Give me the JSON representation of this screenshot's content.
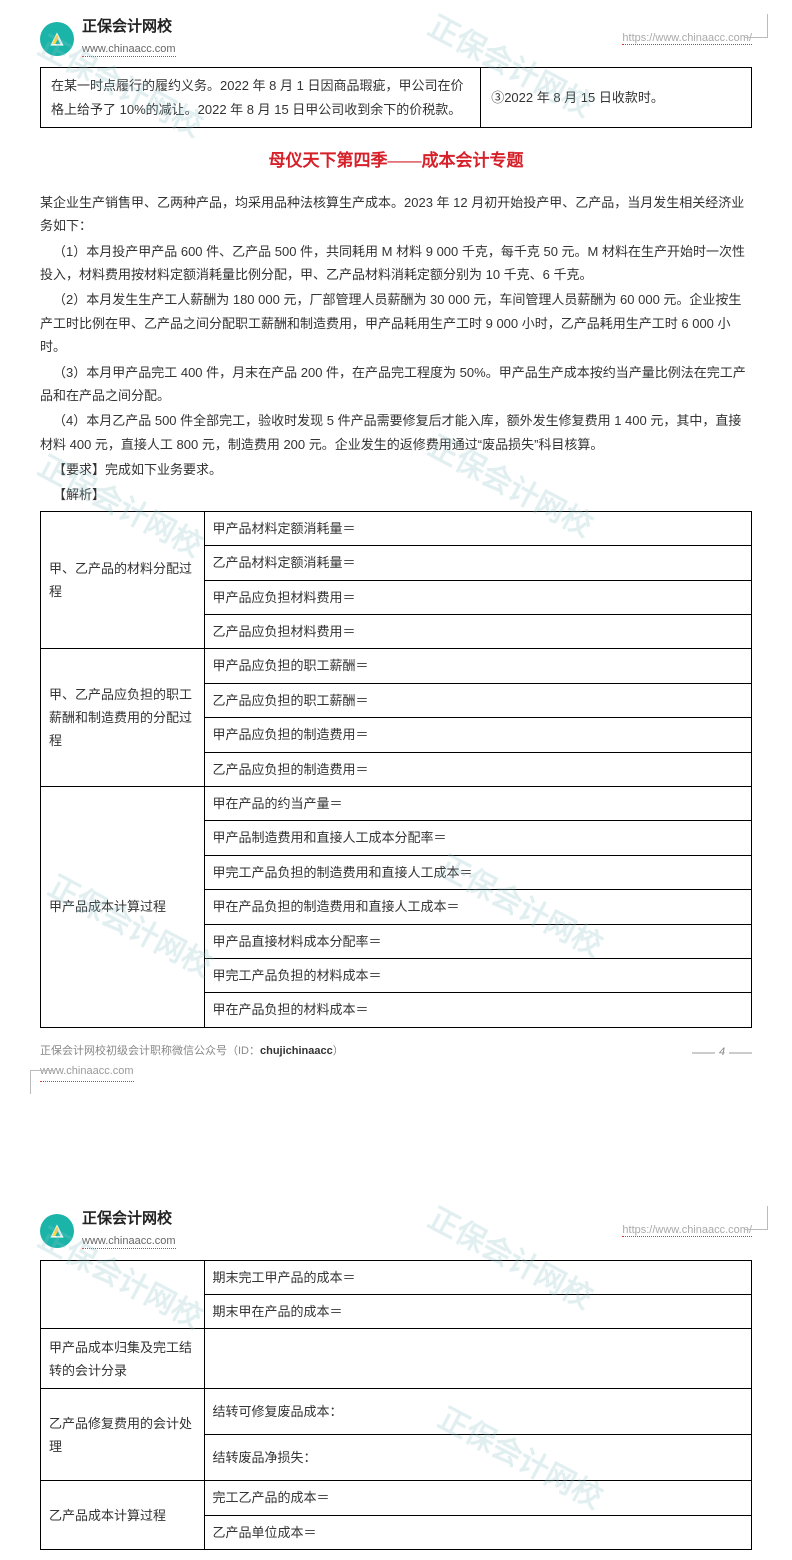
{
  "brand": {
    "cn": "正保会计网校",
    "en": "www.chinaacc.com"
  },
  "header_url": "https://www.chinaacc.com/",
  "topbox": {
    "left": "在某一时点履行的履约义务。2022 年 8 月 1 日因商品瑕疵，甲公司在价格上给予了 10%的减让。2022 年 8 月 15 日甲公司收到余下的价税款。",
    "right": "③2022 年 8 月 15 日收款时。"
  },
  "title": "母仪天下第四季——成本会计专题",
  "body": {
    "p1": "某企业生产销售甲、乙两种产品，均采用品种法核算生产成本。2023 年 12 月初开始投产甲、乙产品，当月发生相关经济业务如下：",
    "p2": "（1）本月投产甲产品 600 件、乙产品 500 件，共同耗用 M 材料 9 000 千克，每千克 50 元。M 材料在生产开始时一次性投入，材料费用按材料定额消耗量比例分配，甲、乙产品材料消耗定额分别为 10 千克、6 千克。",
    "p3": "（2）本月发生生产工人薪酬为 180 000 元，厂部管理人员薪酬为 30 000 元，车间管理人员薪酬为 60 000 元。企业按生产工时比例在甲、乙产品之间分配职工薪酬和制造费用，甲产品耗用生产工时 9 000 小时，乙产品耗用生产工时 6 000 小时。",
    "p4": "（3）本月甲产品完工 400 件，月末在产品 200 件，在产品完工程度为 50%。甲产品生产成本按约当产量比例法在完工产品和在产品之间分配。",
    "p5": "（4）本月乙产品 500 件全部完工，验收时发现 5 件产品需要修复后才能入库，额外发生修复费用 1 400 元，其中，直接材料 400 元，直接人工 800 元，制造费用 200 元。企业发生的返修费用通过“废品损失”科目核算。",
    "req": "【要求】完成如下业务要求。",
    "ans": "【解析】"
  },
  "table1": {
    "r1": {
      "lbl": "甲、乙产品的材料分配过程",
      "c": [
        "甲产品材料定额消耗量＝",
        "乙产品材料定额消耗量＝",
        "甲产品应负担材料费用＝",
        "乙产品应负担材料费用＝"
      ]
    },
    "r2": {
      "lbl": "甲、乙产品应负担的职工薪酬和制造费用的分配过程",
      "c": [
        "甲产品应负担的职工薪酬＝",
        "乙产品应负担的职工薪酬＝",
        "甲产品应负担的制造费用＝",
        "乙产品应负担的制造费用＝"
      ]
    },
    "r3": {
      "lbl": "甲产品成本计算过程",
      "c": [
        "甲在产品的约当产量＝",
        "甲产品制造费用和直接人工成本分配率＝",
        "甲完工产品负担的制造费用和直接人工成本＝",
        "甲在产品负担的制造费用和直接人工成本＝",
        "甲产品直接材料成本分配率＝",
        "甲完工产品负担的材料成本＝",
        "甲在产品负担的材料成本＝"
      ]
    }
  },
  "footer": {
    "text_prefix": "正保会计网校初级会计职称微信公众号（ID：",
    "wx_id": "chujichinaacc",
    "text_suffix": "）",
    "url": "www.chinaacc.com",
    "pageno": "4"
  },
  "table2": {
    "r0": {
      "lbl": "",
      "c": [
        "期末完工甲产品的成本＝",
        "期末甲在产品的成本＝"
      ]
    },
    "r1": {
      "lbl": "甲产品成本归集及完工结转的会计分录",
      "c": [
        ""
      ]
    },
    "r2": {
      "lbl": "乙产品修复费用的会计处理",
      "c": [
        "结转可修复废品成本：",
        "结转废品净损失："
      ]
    },
    "r3": {
      "lbl": "乙产品成本计算过程",
      "c": [
        "完工乙产品的成本＝",
        "乙产品单位成本＝"
      ]
    }
  },
  "watermark": "正保会计网校"
}
